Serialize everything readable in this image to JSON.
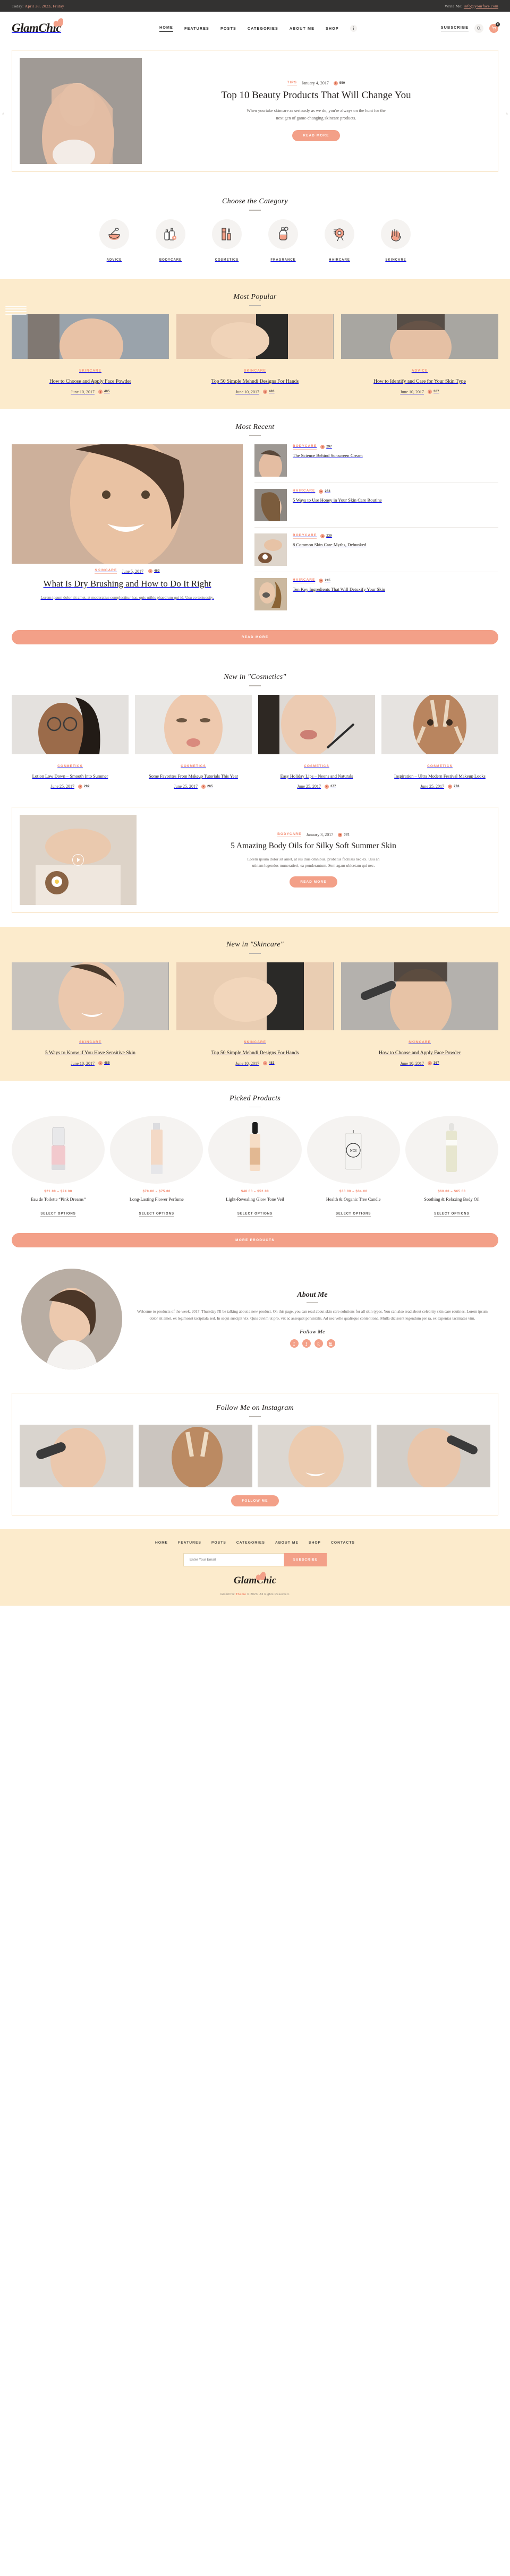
{
  "topbar": {
    "today_label": "Today:",
    "today_value": "April 28, 2023, Friday",
    "write_label": "Write Me:",
    "write_value": "info@yourface.com"
  },
  "brand": {
    "name": "GlamChic"
  },
  "nav": {
    "items": [
      {
        "label": "HOME",
        "active": true
      },
      {
        "label": "FEATURES",
        "active": false
      },
      {
        "label": "POSTS",
        "active": false
      },
      {
        "label": "CATEGORIES",
        "active": false
      },
      {
        "label": "ABOUT ME",
        "active": false
      },
      {
        "label": "SHOP",
        "active": false
      }
    ],
    "more_icon": "vertical-dots-icon",
    "subscribe_label": "SUBSCRIBE",
    "search_icon": "search-icon",
    "cart_icon": "cart-icon",
    "cart_count": "0"
  },
  "hero": {
    "category": "TIPS",
    "date": "January 4, 2017",
    "views": "559",
    "title": "Top 10 Beauty Products That Will Change You",
    "desc": "When you take skincare as seriously as we do, you're always on the hunt for the next gen of game-changing skincare products.",
    "button": "READ MORE",
    "prev_icon": "chevron-left-icon",
    "next_icon": "chevron-right-icon"
  },
  "categories": {
    "title": "Choose the Category",
    "items": [
      {
        "label": "ADVICE",
        "icon": "mask-bowl-icon"
      },
      {
        "label": "BODYCARE",
        "icon": "lotion-bottles-icon"
      },
      {
        "label": "COSMETICS",
        "icon": "mascara-icon"
      },
      {
        "label": "FRAGRANCE",
        "icon": "perfume-icon"
      },
      {
        "label": "HAIRCARE",
        "icon": "hairdryer-icon"
      },
      {
        "label": "SKINCARE",
        "icon": "hand-icon"
      }
    ]
  },
  "most_popular": {
    "title": "Most Popular",
    "posts": [
      {
        "category": "SKINCARE",
        "title": "How to Choose and Apply Face Powder",
        "date": "June 10, 2017",
        "views": "485"
      },
      {
        "category": "SKINCARE",
        "title": "Top 50 Simple Mehndi Designs For Hands",
        "date": "June 10, 2017",
        "views": "483"
      },
      {
        "category": "ADVICE",
        "title": "How to Identify and Care for Your Skin Type",
        "date": "June 10, 2017",
        "views": "367"
      }
    ]
  },
  "most_recent": {
    "title": "Most Recent",
    "main": {
      "category": "SKINCARE",
      "date": "June 5, 2017",
      "views": "463",
      "title": "What Is Dry Brushing and How to Do It Right",
      "desc": "Lorem ipsum dolor sit amet, at moderatius complectitur has, quis utibis phaedrum qui id. Usu co tortuosity."
    },
    "side": [
      {
        "category": "BODYCARE",
        "views": "297",
        "title": "The Science Behind Sunscreen Cream"
      },
      {
        "category": "HAIRCARE",
        "views": "253",
        "title": "5 Ways to Use Honey in Your Skin Care Routine"
      },
      {
        "category": "BODYCARE",
        "views": "239",
        "title": "8 Common Skin Care Myths, Debunked"
      },
      {
        "category": "HAIRCARE",
        "views": "245",
        "title": "Ten Key Ingredients That Will Detoxify Your Skin"
      }
    ],
    "read_more": "READ MORE"
  },
  "new_in_cosmetics": {
    "title": "New in \"Cosmetics\"",
    "posts": [
      {
        "category": "COSMETICS",
        "title": "Lotion Low Down – Smooth Into Summer",
        "date": "June 25, 2017",
        "views": "292"
      },
      {
        "category": "COSMETICS",
        "title": "Some Favorites From Makeup Tutorials This Year",
        "date": "June 25, 2017",
        "views": "285"
      },
      {
        "category": "COSMETICS",
        "title": "Easy Holiday Lips – Neons and Naturals",
        "date": "June 25, 2017",
        "views": "277"
      },
      {
        "category": "COSMETICS",
        "title": "Inspiration – Ultra Modern Festival Makeup Looks",
        "date": "June 25, 2017",
        "views": "278"
      }
    ]
  },
  "feature_post": {
    "category": "BODYCARE",
    "date": "January 3, 2017",
    "views": "381",
    "title": "5 Amazing Body Oils for Silky Soft Summer Skin",
    "desc": "Lorem ipsum dolor sit amet, at ius duis omnibus, probatus facilisis nec ex. Usu an utinam legendos muneratieri, ea ponderantum. Sem agam ubicetam qui nec.",
    "button": "READ MORE",
    "play_icon": "play-icon"
  },
  "new_in_skincare": {
    "title": "New in \"Skincare\"",
    "posts": [
      {
        "category": "SKINCARE",
        "title": "5 Ways to Know if You Have Sensitive Skin",
        "date": "June 10, 2017",
        "views": "485"
      },
      {
        "category": "SKINCARE",
        "title": "Top 50 Simple Mehndi Designs For Hands",
        "date": "June 10, 2017",
        "views": "483"
      },
      {
        "category": "SKINCARE",
        "title": "How to Choose and Apply Face Powder",
        "date": "June 10, 2017",
        "views": "367"
      }
    ]
  },
  "picked_products": {
    "title": "Picked Products",
    "items": [
      {
        "price": "$21.00 – $24.00",
        "name": "Eau de Toilette “Pink Dreams”",
        "cta": "SELECT OPTIONS"
      },
      {
        "price": "$70.00 – $75.00",
        "name": "Long-Lasting Flower Perfume",
        "cta": "SELECT OPTIONS"
      },
      {
        "price": "$48.00 – $52.00",
        "name": "Light-Revealing Glow Tone Veil",
        "cta": "SELECT OPTIONS"
      },
      {
        "price": "$30.00 – $34.00",
        "name": "Health & Organic Tree Candle",
        "cta": "SELECT OPTIONS"
      },
      {
        "price": "$60.00 – $65.00",
        "name": "Soothing & Relaxing Body Oil",
        "cta": "SELECT OPTIONS"
      }
    ],
    "more_button": "MORE PRODUCTS"
  },
  "about": {
    "title": "About Me",
    "text": "Welcome to products of the week, 2017. Thursday I'll be talking about a new product. On this page, you can read about skin care solutions for all skin types. You can also read about celebrity skin care routines. Lorem ipsum dolor sit amet, ex legimonst tacipitala sed. In sequi suscipit vix. Quis cuvim ut pro, vix ac assequet ponsistilis. Ad nec velle qualisque contentione. Mulla dicissent legendum per ra, ex expenias tacimates vim.",
    "follow_label": "Follow Me",
    "socials": [
      "f",
      "t",
      "p",
      "in"
    ]
  },
  "instagram": {
    "title": "Follow Me on Instagram",
    "button": "FOLLOW ME"
  },
  "footer": {
    "nav": [
      "HOME",
      "FEATURES",
      "POSTS",
      "CATEGORIES",
      "ABOUT ME",
      "SHOP",
      "CONTACTS"
    ],
    "email_placeholder": "Enter Your Email",
    "subscribe_button": "SUBSCRIBE",
    "brand": "GlamChic",
    "copyright_pre": "GlamChic ",
    "copyright_theme": "Theme",
    "copyright_post": " © 2023. All Rights Reserved."
  },
  "colors": {
    "accent": "#f3a088",
    "accent_text": "#f3866a",
    "cream": "#fcebcc",
    "dark": "#333231"
  }
}
